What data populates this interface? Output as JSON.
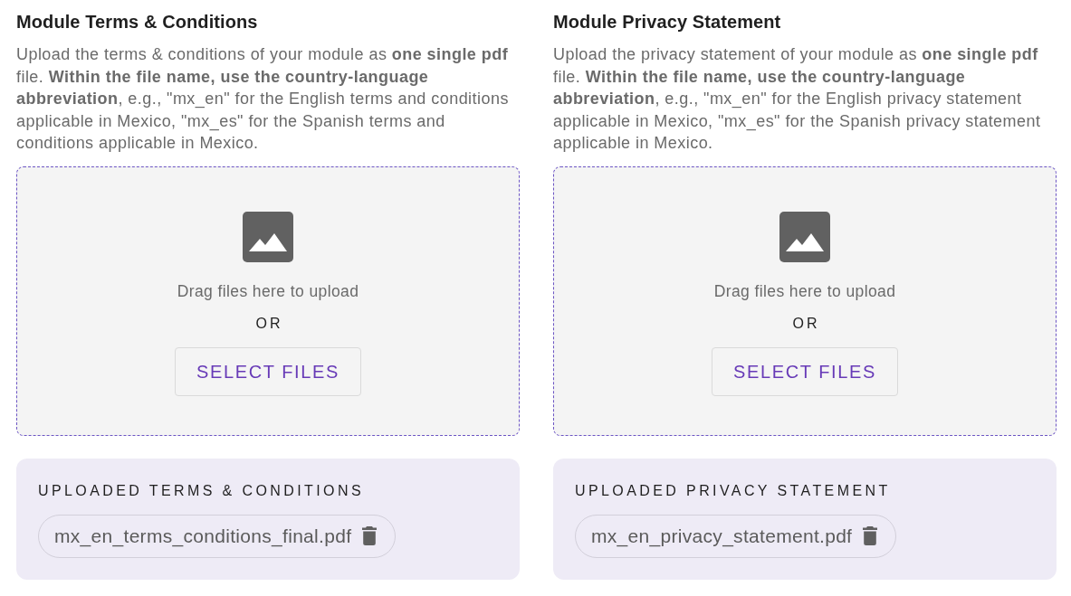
{
  "sections": [
    {
      "title": "Module Terms & Conditions",
      "description": "Upload the terms & conditions of your module as **one single pdf** file. **Within the file name, use the country-language abbreviation**, e.g., \"mx_en\" for the English terms and conditions applicable in Mexico, \"mx_es\" for the Spanish terms and conditions applicable in Mexico.",
      "dropzone": {
        "prompt": "Drag files here to upload",
        "separator": "OR",
        "button": "SELECT FILES"
      },
      "uploaded": {
        "heading": "UPLOADED TERMS & CONDITIONS",
        "files": [
          {
            "name": "mx_en_terms_conditions_final.pdf"
          }
        ]
      }
    },
    {
      "title": "Module Privacy Statement",
      "description": "Upload the privacy statement of your module as **one single pdf** file. **Within the file name, use the country-language abbreviation**, e.g., \"mx_en\" for the English privacy statement applicable in Mexico, \"mx_es\" for the Spanish privacy statement applicable in Mexico.",
      "dropzone": {
        "prompt": "Drag files here to upload",
        "separator": "OR",
        "button": "SELECT FILES"
      },
      "uploaded": {
        "heading": "UPLOADED PRIVACY STATEMENT",
        "files": [
          {
            "name": "mx_en_privacy_statement.pdf"
          }
        ]
      }
    }
  ]
}
